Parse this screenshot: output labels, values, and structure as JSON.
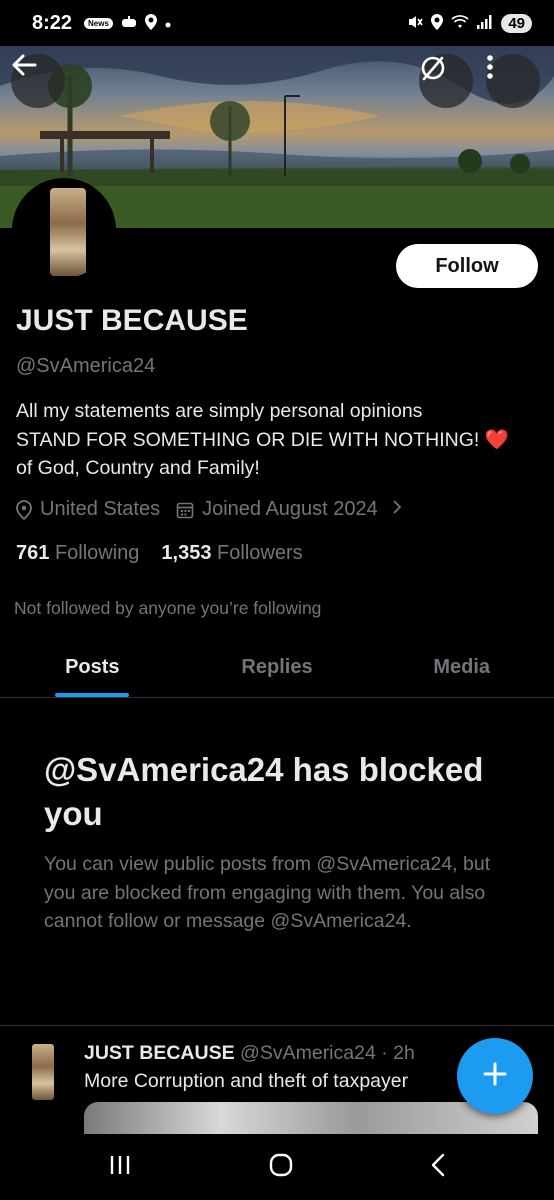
{
  "status_bar": {
    "time": "8:22",
    "news_badge": "News",
    "battery": "49"
  },
  "profile": {
    "display_name": "JUST BECAUSE",
    "handle": "@SvAmerica24",
    "follow_label": "Follow",
    "bio_lines": [
      "All my statements are simply personal opinions",
      "STAND FOR SOMETHING OR DIE WITH NOTHING! ❤️",
      "of God, Country and Family!"
    ],
    "location": "United States",
    "joined": "Joined August 2024",
    "following_count": "761",
    "following_label": "Following",
    "followers_count": "1,353",
    "followers_label": "Followers",
    "not_followed": "Not followed by anyone you’re following"
  },
  "tabs": [
    {
      "label": "Posts",
      "active": true
    },
    {
      "label": "Replies",
      "active": false
    },
    {
      "label": "Media",
      "active": false
    }
  ],
  "blocked": {
    "title": "@SvAmerica24 has blocked you",
    "body": "You can view public posts from @SvAmerica24, but you are blocked from engaging with them. You also cannot follow or message @SvAmerica24."
  },
  "post": {
    "name": "JUST BECAUSE",
    "handle_time": "@SvAmerica24 · 2h",
    "text": "More Corruption and theft of taxpayer"
  },
  "colors": {
    "accent": "#1d9bf0",
    "background": "#000000",
    "text_primary": "#e7e9ea",
    "text_secondary": "#71767b"
  },
  "icons": {
    "back": "arrow-left-icon",
    "unfollow": "slashed-circle-icon",
    "more": "vertical-dots-icon",
    "location": "location-pin-icon",
    "calendar": "calendar-icon",
    "compose": "plus-icon"
  }
}
